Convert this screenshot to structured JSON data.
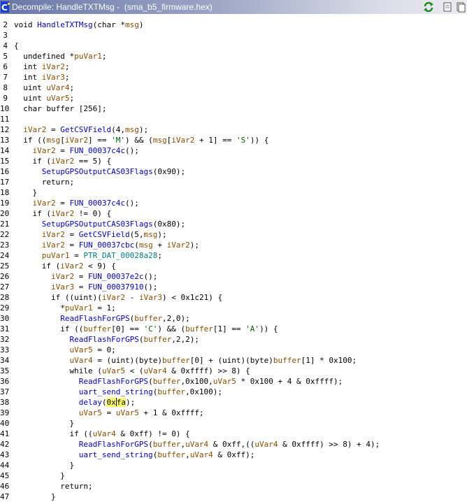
{
  "window": {
    "title": "Decompile: HandleTXTMsg -  (sma_b5_firmware.hex)"
  },
  "colors": {
    "function": "#0000cc",
    "variable": "#8a4c00",
    "constant": "#006000",
    "global": "#008080",
    "highlight": "#ffff66"
  },
  "icons": [
    "decompiler-app-icon",
    "refresh-icon",
    "snapshot-icon",
    "more-icon"
  ],
  "code_lines": [
    {
      "n": "2",
      "segs": [
        [
          "void ",
          ""
        ],
        [
          "HandleTXTMsg",
          "fn"
        ],
        [
          "(char *",
          ""
        ],
        [
          "msg",
          "var"
        ],
        [
          ")",
          ""
        ]
      ]
    },
    {
      "n": "3",
      "segs": []
    },
    {
      "n": "4",
      "segs": [
        [
          "{",
          ""
        ]
      ]
    },
    {
      "n": "5",
      "segs": [
        [
          "  undefined *",
          ""
        ],
        [
          "puVar1",
          "var"
        ],
        [
          ";",
          ""
        ]
      ]
    },
    {
      "n": "6",
      "segs": [
        [
          "  int ",
          ""
        ],
        [
          "iVar2",
          "var"
        ],
        [
          ";",
          ""
        ]
      ]
    },
    {
      "n": "7",
      "segs": [
        [
          "  int ",
          ""
        ],
        [
          "iVar3",
          "var"
        ],
        [
          ";",
          ""
        ]
      ]
    },
    {
      "n": "8",
      "segs": [
        [
          "  uint ",
          ""
        ],
        [
          "uVar4",
          "var"
        ],
        [
          ";",
          ""
        ]
      ]
    },
    {
      "n": "9",
      "segs": [
        [
          "  uint ",
          ""
        ],
        [
          "uVar5",
          "var"
        ],
        [
          ";",
          ""
        ]
      ]
    },
    {
      "n": "10",
      "segs": [
        [
          "  char buffer [256];",
          ""
        ]
      ]
    },
    {
      "n": "11",
      "segs": []
    },
    {
      "n": "12",
      "segs": [
        [
          "  ",
          ""
        ],
        [
          "iVar2",
          "var"
        ],
        [
          " = ",
          ""
        ],
        [
          "GetCSVField",
          "fn"
        ],
        [
          "(4,",
          ""
        ],
        [
          "msg",
          "var"
        ],
        [
          ");",
          ""
        ]
      ]
    },
    {
      "n": "13",
      "segs": [
        [
          "  if ((",
          ""
        ],
        [
          "msg",
          "var"
        ],
        [
          "[",
          ""
        ],
        [
          "iVar2",
          "var"
        ],
        [
          "] == ",
          ""
        ],
        [
          "'M'",
          "str"
        ],
        [
          ") && (",
          ""
        ],
        [
          "msg",
          "var"
        ],
        [
          "[",
          ""
        ],
        [
          "iVar2",
          "var"
        ],
        [
          " + 1] == ",
          ""
        ],
        [
          "'S'",
          "str"
        ],
        [
          ")) {",
          ""
        ]
      ]
    },
    {
      "n": "14",
      "segs": [
        [
          "    ",
          ""
        ],
        [
          "iVar2",
          "var"
        ],
        [
          " = ",
          ""
        ],
        [
          "FUN_00037c4c",
          "fn"
        ],
        [
          "();",
          ""
        ]
      ]
    },
    {
      "n": "15",
      "segs": [
        [
          "    if (",
          ""
        ],
        [
          "iVar2",
          "var"
        ],
        [
          " == 5) {",
          ""
        ]
      ]
    },
    {
      "n": "16",
      "segs": [
        [
          "      ",
          ""
        ],
        [
          "SetupGPSOutputCAS03Flags",
          "fn"
        ],
        [
          "(0x90);",
          ""
        ]
      ]
    },
    {
      "n": "17",
      "segs": [
        [
          "      return;",
          ""
        ]
      ]
    },
    {
      "n": "18",
      "segs": [
        [
          "    }",
          ""
        ]
      ]
    },
    {
      "n": "19",
      "segs": [
        [
          "    ",
          ""
        ],
        [
          "iVar2",
          "var"
        ],
        [
          " = ",
          ""
        ],
        [
          "FUN_00037c4c",
          "fn"
        ],
        [
          "();",
          ""
        ]
      ]
    },
    {
      "n": "20",
      "segs": [
        [
          "    if (",
          ""
        ],
        [
          "iVar2",
          "var"
        ],
        [
          " != 0) {",
          ""
        ]
      ]
    },
    {
      "n": "21",
      "segs": [
        [
          "      ",
          ""
        ],
        [
          "SetupGPSOutputCAS03Flags",
          "fn"
        ],
        [
          "(0x80);",
          ""
        ]
      ]
    },
    {
      "n": "22",
      "segs": [
        [
          "      ",
          ""
        ],
        [
          "iVar2",
          "var"
        ],
        [
          " = ",
          ""
        ],
        [
          "GetCSVField",
          "fn"
        ],
        [
          "(5,",
          ""
        ],
        [
          "msg",
          "var"
        ],
        [
          ");",
          ""
        ]
      ]
    },
    {
      "n": "23",
      "segs": [
        [
          "      ",
          ""
        ],
        [
          "iVar2",
          "var"
        ],
        [
          " = ",
          ""
        ],
        [
          "FUN_00037cbc",
          "fn"
        ],
        [
          "(",
          ""
        ],
        [
          "msg",
          "var"
        ],
        [
          " + ",
          ""
        ],
        [
          "iVar2",
          "var"
        ],
        [
          ");",
          ""
        ]
      ]
    },
    {
      "n": "24",
      "segs": [
        [
          "      ",
          ""
        ],
        [
          "puVar1",
          "var"
        ],
        [
          " = ",
          ""
        ],
        [
          "PTR_DAT_00028a28",
          "glob"
        ],
        [
          ";",
          ""
        ]
      ]
    },
    {
      "n": "25",
      "segs": [
        [
          "      if (",
          ""
        ],
        [
          "iVar2",
          "var"
        ],
        [
          " < 9) {",
          ""
        ]
      ]
    },
    {
      "n": "26",
      "segs": [
        [
          "        ",
          ""
        ],
        [
          "iVar2",
          "var"
        ],
        [
          " = ",
          ""
        ],
        [
          "FUN_00037e2c",
          "fn"
        ],
        [
          "();",
          ""
        ]
      ]
    },
    {
      "n": "27",
      "segs": [
        [
          "        ",
          ""
        ],
        [
          "iVar3",
          "var"
        ],
        [
          " = ",
          ""
        ],
        [
          "FUN_00037910",
          "fn"
        ],
        [
          "();",
          ""
        ]
      ]
    },
    {
      "n": "28",
      "segs": [
        [
          "        if ((uint)(",
          ""
        ],
        [
          "iVar2",
          "var"
        ],
        [
          " - ",
          ""
        ],
        [
          "iVar3",
          "var"
        ],
        [
          ") < 0x1c21) {",
          ""
        ]
      ]
    },
    {
      "n": "29",
      "segs": [
        [
          "          *",
          ""
        ],
        [
          "puVar1",
          "var"
        ],
        [
          " = 1;",
          ""
        ]
      ]
    },
    {
      "n": "30",
      "segs": [
        [
          "          ",
          ""
        ],
        [
          "ReadFlashForGPS",
          "fn"
        ],
        [
          "(",
          ""
        ],
        [
          "buffer",
          "var"
        ],
        [
          ",2,0);",
          ""
        ]
      ]
    },
    {
      "n": "31",
      "segs": [
        [
          "          if ((",
          ""
        ],
        [
          "buffer",
          "var"
        ],
        [
          "[0] == ",
          ""
        ],
        [
          "'C'",
          "str"
        ],
        [
          ") && (",
          ""
        ],
        [
          "buffer",
          "var"
        ],
        [
          "[1] == ",
          ""
        ],
        [
          "'A'",
          "str"
        ],
        [
          ")) {",
          ""
        ]
      ]
    },
    {
      "n": "32",
      "segs": [
        [
          "            ",
          ""
        ],
        [
          "ReadFlashForGPS",
          "fn"
        ],
        [
          "(",
          ""
        ],
        [
          "buffer",
          "var"
        ],
        [
          ",2,2);",
          ""
        ]
      ]
    },
    {
      "n": "33",
      "segs": [
        [
          "            ",
          ""
        ],
        [
          "uVar5",
          "var"
        ],
        [
          " = 0;",
          ""
        ]
      ]
    },
    {
      "n": "34",
      "segs": [
        [
          "            ",
          ""
        ],
        [
          "uVar4",
          "var"
        ],
        [
          " = (uint)(byte)",
          ""
        ],
        [
          "buffer",
          "var"
        ],
        [
          "[0] + (uint)(byte)",
          ""
        ],
        [
          "buffer",
          "var"
        ],
        [
          "[1] * 0x100;",
          ""
        ]
      ]
    },
    {
      "n": "35",
      "segs": [
        [
          "            while (",
          ""
        ],
        [
          "uVar5",
          "var"
        ],
        [
          " < (",
          ""
        ],
        [
          "uVar4",
          "var"
        ],
        [
          " & 0xffff) >> 8) {",
          ""
        ]
      ]
    },
    {
      "n": "36",
      "segs": [
        [
          "              ",
          ""
        ],
        [
          "ReadFlashForGPS",
          "fn"
        ],
        [
          "(",
          ""
        ],
        [
          "buffer",
          "var"
        ],
        [
          ",0x100,",
          ""
        ],
        [
          "uVar5",
          "var"
        ],
        [
          " * 0x100 + 4 & 0xffff);",
          ""
        ]
      ]
    },
    {
      "n": "37",
      "segs": [
        [
          "              ",
          ""
        ],
        [
          "uart_send_string",
          "fn"
        ],
        [
          "(",
          ""
        ],
        [
          "buffer",
          "var"
        ],
        [
          ",0x100);",
          ""
        ]
      ]
    },
    {
      "n": "38",
      "segs": [
        [
          "              ",
          ""
        ],
        [
          "delay",
          "fn"
        ],
        [
          "(",
          ""
        ],
        [
          "0x",
          "hl"
        ],
        [
          "|",
          "caret"
        ],
        [
          "fa",
          "hl"
        ],
        [
          ");",
          ""
        ]
      ]
    },
    {
      "n": "39",
      "segs": [
        [
          "              ",
          ""
        ],
        [
          "uVar5",
          "var"
        ],
        [
          " = ",
          ""
        ],
        [
          "uVar5",
          "var"
        ],
        [
          " + 1 & 0xffff;",
          ""
        ]
      ]
    },
    {
      "n": "40",
      "segs": [
        [
          "            }",
          ""
        ]
      ]
    },
    {
      "n": "41",
      "segs": [
        [
          "            if ((",
          ""
        ],
        [
          "uVar4",
          "var"
        ],
        [
          " & 0xff) != 0) {",
          ""
        ]
      ]
    },
    {
      "n": "42",
      "segs": [
        [
          "              ",
          ""
        ],
        [
          "ReadFlashForGPS",
          "fn"
        ],
        [
          "(",
          ""
        ],
        [
          "buffer",
          "var"
        ],
        [
          ",",
          ""
        ],
        [
          "uVar4",
          "var"
        ],
        [
          " & 0xff,((",
          ""
        ],
        [
          "uVar4",
          "var"
        ],
        [
          " & 0xffff) >> 8) + 4);",
          ""
        ]
      ]
    },
    {
      "n": "43",
      "segs": [
        [
          "              ",
          ""
        ],
        [
          "uart_send_string",
          "fn"
        ],
        [
          "(",
          ""
        ],
        [
          "buffer",
          "var"
        ],
        [
          ",",
          ""
        ],
        [
          "uVar4",
          "var"
        ],
        [
          " & 0xff);",
          ""
        ]
      ]
    },
    {
      "n": "44",
      "segs": [
        [
          "            }",
          ""
        ]
      ]
    },
    {
      "n": "45",
      "segs": [
        [
          "          }",
          ""
        ]
      ]
    },
    {
      "n": "46",
      "segs": [
        [
          "          return;",
          ""
        ]
      ]
    },
    {
      "n": "47",
      "segs": [
        [
          "        }",
          ""
        ]
      ]
    }
  ]
}
